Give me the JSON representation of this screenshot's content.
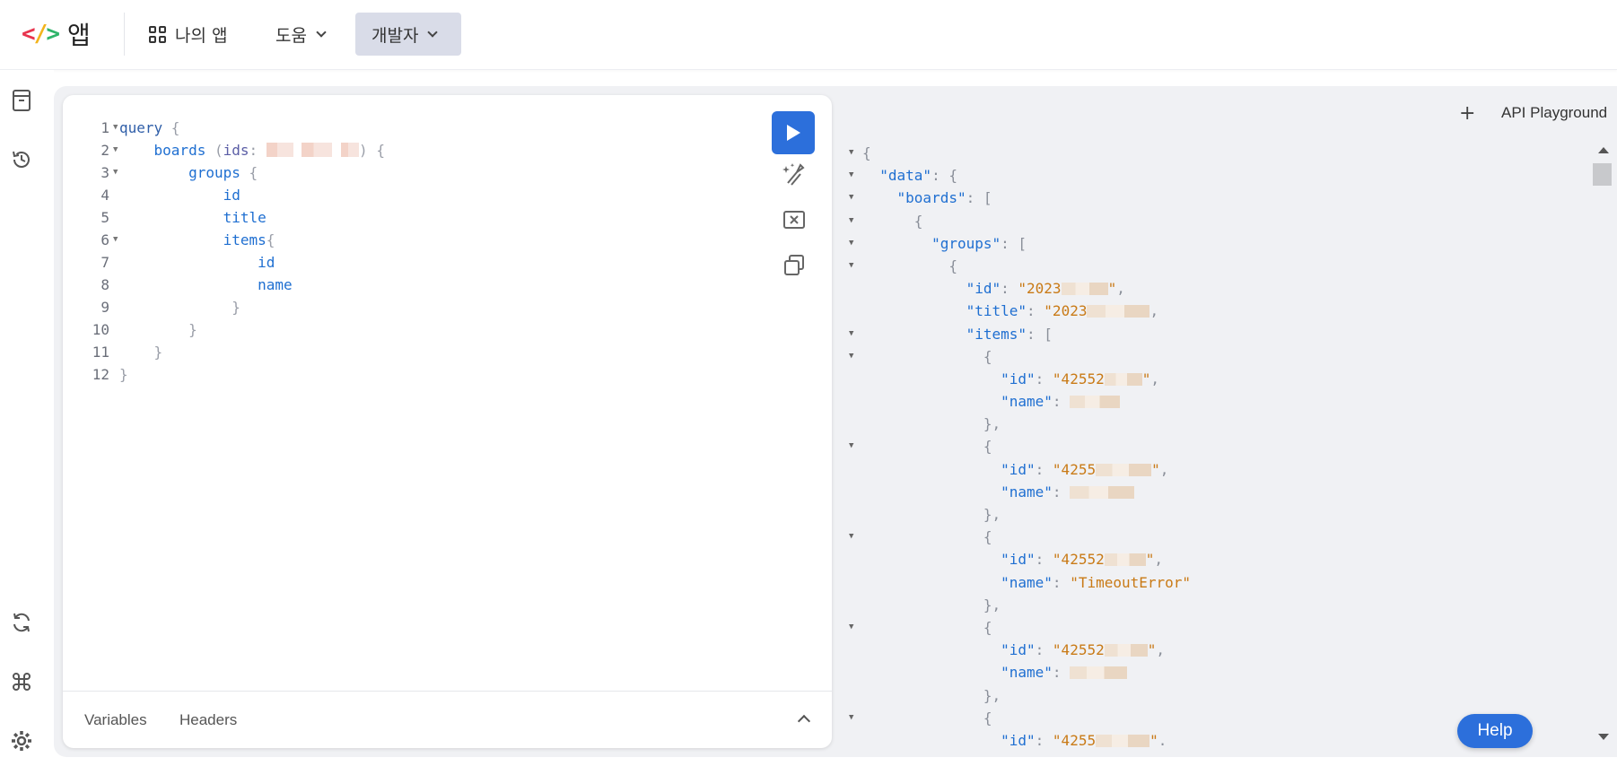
{
  "app": {
    "logo_mark_lt": "<",
    "logo_mark_slash": "/",
    "logo_mark_gt": ">",
    "logo_text": "앱"
  },
  "nav": {
    "my_apps": "나의 앱",
    "help": "도움",
    "developer": "개발자"
  },
  "sidebar": {
    "icons": [
      "archive-icon",
      "history-icon",
      "refresh-icon",
      "command-icon",
      "settings-icon"
    ]
  },
  "editor": {
    "line_numbers": [
      "1",
      "2",
      "3",
      "4",
      "5",
      "6",
      "7",
      "8",
      "9",
      "10",
      "11",
      "12"
    ],
    "lines": {
      "l1_kw": "query",
      "l1_brace": " {",
      "l2_field": "boards",
      "l2_open": " (",
      "l2_arg": "ids",
      "l2_colon": ": ",
      "l2_close": ") {",
      "l3_field": "groups",
      "l3_brace": " {",
      "l4_field": "id",
      "l5_field": "title",
      "l6_field": "items",
      "l6_brace": "{",
      "l7_field": "id",
      "l8_field": "name",
      "l9_close": "}",
      "l10_close": "}",
      "l11_close": "}",
      "l12_close": "}"
    },
    "footer": {
      "variables_tab": "Variables",
      "headers_tab": "Headers"
    }
  },
  "result": {
    "add_label": "+",
    "title": "API Playground",
    "json": {
      "open": "{",
      "data_key": "\"data\"",
      "boards_key": "\"boards\"",
      "groups_key": "\"groups\"",
      "id_key": "\"id\"",
      "title_key": "\"title\"",
      "items_key": "\"items\"",
      "name_key": "\"name\"",
      "group_id_prefix": "\"2023",
      "group_title_prefix": "\"2023",
      "item1_id_prefix": "\"42552",
      "item2_id_prefix": "\"4255",
      "item3_id_prefix": "\"42552",
      "item3_name": "\"TimeoutError\"",
      "item4_id_prefix": "\"42552",
      "item5_id_prefix": "\"4255"
    }
  },
  "help_button": "Help",
  "colors": {
    "accent": "#2c6fdb",
    "nav_active_bg": "#d9dce8",
    "json_key": "#1f6fd1",
    "json_string": "#c97a16"
  }
}
